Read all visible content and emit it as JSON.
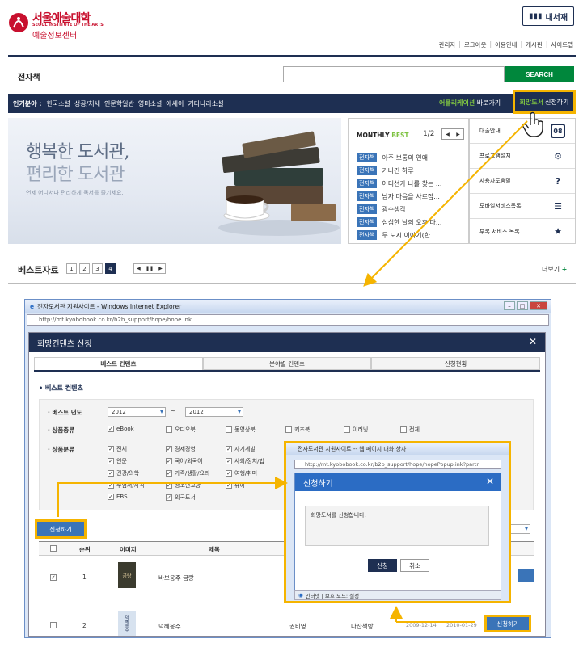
{
  "header": {
    "logo_main": "서울예술대학",
    "logo_en": "SEOUL INSTITUTE OF THE ARTS",
    "logo_sub": "예술정보센터",
    "my_library": "내서재",
    "links": [
      "관리자",
      "로그아웃",
      "이용안내",
      "게시판",
      "사이트맵"
    ]
  },
  "search": {
    "section_title": "전자책",
    "placeholder": "",
    "button": "SEARCH"
  },
  "category_bar": {
    "label": "인기분야 :",
    "items": [
      "한국소설",
      "성공/처세",
      "인문학일반",
      "영미소설",
      "에세이",
      "기타나라소설"
    ],
    "app_highlight": "어플리케이션",
    "app_rest": "바로가기",
    "hope_highlight": "희망도서",
    "hope_rest": "신청하기"
  },
  "banner": {
    "line1": "행복한 도서관,",
    "line2": "편리한 도서관",
    "sub": "언제 어디서나 편리하게 독서를 즐기세요."
  },
  "monthly_best": {
    "title_a": "MONTHLY",
    "title_b": "BEST",
    "page": "1/2",
    "tag": "전자책",
    "items": [
      "아주 보통의 연애",
      "기나긴 하루",
      "어디선가 나를 찾는 ...",
      "남자 마음을 사로잡...",
      "광수생각",
      "심심한 날의 오후 다...",
      "두 도시 이야기(한..."
    ]
  },
  "side_menu": [
    {
      "label": "대출안내",
      "icon": "calendar-icon",
      "glyph": "08"
    },
    {
      "label": "프로그램설치",
      "icon": "gear-icon",
      "glyph": "⚙"
    },
    {
      "label": "사용자도움말",
      "icon": "question-icon",
      "glyph": "?"
    },
    {
      "label": "모바일서비스목록",
      "icon": "list-icon",
      "glyph": "☰"
    },
    {
      "label": "부록 서비스 목록",
      "icon": "star-icon",
      "glyph": "★"
    }
  ],
  "best": {
    "title": "베스트자료",
    "pages": [
      "1",
      "2",
      "3",
      "4"
    ],
    "active_page": "4",
    "more": "더보기",
    "more_plus": "+"
  },
  "ie_window": {
    "title": "전자도서관 지원사이트 - Windows Internet Explorer",
    "url": "http://mt.kyobobook.co.kr/b2b_support/hope/hope.ink"
  },
  "modal": {
    "title": "희망컨텐츠 신청",
    "tabs": [
      "베스트 컨텐츠",
      "분야별 컨텐츠",
      "신청현황"
    ],
    "section": "베스트 컨텐츠",
    "year_label": "베스트 년도",
    "year_from": "2012",
    "year_sep": "~",
    "year_to": "2012",
    "type_label": "상품종류",
    "types": [
      {
        "label": "eBook",
        "checked": true
      },
      {
        "label": "오디오북",
        "checked": false
      },
      {
        "label": "동영상북",
        "checked": false
      },
      {
        "label": "키즈북",
        "checked": false
      },
      {
        "label": "이러닝",
        "checked": false
      },
      {
        "label": "전체",
        "checked": false
      }
    ],
    "class_label": "상품분류",
    "classes": [
      {
        "label": "전체",
        "checked": true
      },
      {
        "label": "경제경영",
        "checked": true
      },
      {
        "label": "자기계발",
        "checked": true
      },
      {
        "label": "인문",
        "checked": true
      },
      {
        "label": "국어/외국어",
        "checked": true
      },
      {
        "label": "사회/정치/법",
        "checked": true
      },
      {
        "label": "건강/의학",
        "checked": true
      },
      {
        "label": "가족/생활/요리",
        "checked": true
      },
      {
        "label": "여행/취미",
        "checked": true
      },
      {
        "label": "수험서/자격",
        "checked": true
      },
      {
        "label": "청소년교양",
        "checked": true
      },
      {
        "label": "유아",
        "checked": true
      },
      {
        "label": "EBS",
        "checked": true
      },
      {
        "label": "외국도서",
        "checked": true
      }
    ],
    "apply_btn": "신청하기",
    "table_headers": [
      "순위",
      "이미지",
      "제목"
    ],
    "rows": [
      {
        "rank": "1",
        "title": "바보웅주 금랑",
        "checked": true,
        "thumb_text": "금랑"
      },
      {
        "rank": "2",
        "title": "덕혜옹주",
        "checked": false,
        "author": "권비영",
        "publisher": "다산책방",
        "date1": "2009-12-14",
        "date2": "2010-01-29",
        "thumb_text": "덕혜옹주"
      }
    ],
    "row_apply": "신청하기"
  },
  "popup": {
    "title": "전자도서관 지원사이트 -- 웹 페이지 대화 상자",
    "url": "http://mt.kyobobook.co.kr/b2b_support/hope/hopePopup.ink?partn",
    "header": "신청하기",
    "message": "희망도서를 신청합니다.",
    "ok": "신청",
    "cancel": "취소",
    "status": "인터넷 | 보호 모드: 설정"
  },
  "colors": {
    "navy": "#1e2f52",
    "green": "#00873c",
    "accent": "#f5b400",
    "blue": "#3a74b8"
  }
}
